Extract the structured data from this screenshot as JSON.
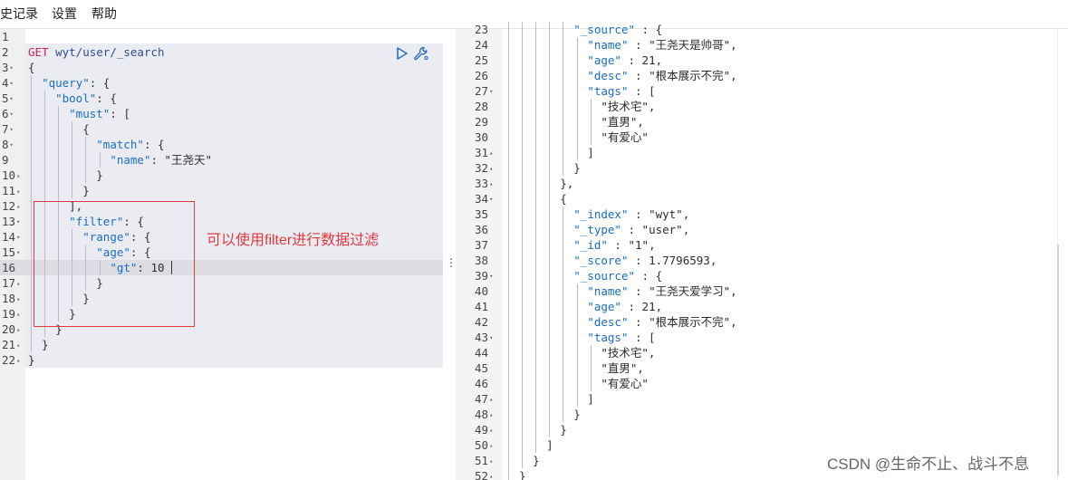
{
  "menu": {
    "items": [
      "史记录",
      "设置",
      "帮助"
    ]
  },
  "request": {
    "method": "GET",
    "url": "wyt/user/_search",
    "lines": [
      "",
      "GET wyt/user/_search",
      "{",
      "  \"query\": {",
      "    \"bool\": {",
      "      \"must\": [",
      "        {",
      "          \"match\": {",
      "            \"name\": \"王尧天\"",
      "          }",
      "        }",
      "      ],",
      "      \"filter\": {",
      "        \"range\": {",
      "          \"age\": {",
      "            \"gt\": 10",
      "          }",
      "        }",
      "      }",
      "    }",
      "  }",
      "}"
    ],
    "gutter": [
      "1",
      "2",
      "3",
      "4",
      "5",
      "6",
      "7",
      "8",
      "9",
      "10",
      "11",
      "12",
      "13",
      "14",
      "15",
      "16",
      "17",
      "18",
      "19",
      "20",
      "21",
      "22"
    ],
    "fold_down": [
      "3",
      "4",
      "5",
      "6",
      "7",
      "8",
      "13",
      "14",
      "15"
    ],
    "fold_up": [
      "10",
      "11",
      "12",
      "17",
      "18",
      "19",
      "20",
      "21",
      "22"
    ]
  },
  "annotation": {
    "text": "可以使用filter进行数据过滤",
    "color": "#e0393e"
  },
  "response": {
    "gutter": [
      "23",
      "24",
      "25",
      "26",
      "27",
      "28",
      "29",
      "30",
      "31",
      "32",
      "33",
      "34",
      "35",
      "36",
      "37",
      "38",
      "39",
      "40",
      "41",
      "42",
      "43",
      "44",
      "45",
      "46",
      "47",
      "48",
      "49",
      "50",
      "51",
      "52"
    ],
    "fold_down": [
      "27",
      "34",
      "39",
      "43"
    ],
    "fold_up": [
      "31",
      "32",
      "33",
      "47",
      "48",
      "49",
      "50",
      "51",
      "52"
    ],
    "lines": [
      "          \"_source\" : {",
      "            \"name\" : \"王尧天是帅哥\",",
      "            \"age\" : 21,",
      "            \"desc\" : \"根本展示不完\",",
      "            \"tags\" : [",
      "              \"技术宅\",",
      "              \"直男\",",
      "              \"有爱心\"",
      "            ]",
      "          }",
      "        },",
      "        {",
      "          \"_index\" : \"wyt\",",
      "          \"_type\" : \"user\",",
      "          \"_id\" : \"1\",",
      "          \"_score\" : 1.7796593,",
      "          \"_source\" : {",
      "            \"name\" : \"王尧天爱学习\",",
      "            \"age\" : 21,",
      "            \"desc\" : \"根本展示不完\",",
      "            \"tags\" : [",
      "              \"技术宅\",",
      "              \"直男\",",
      "              \"有爱心\"",
      "            ]",
      "          }",
      "        }",
      "      ]",
      "    }",
      "  }"
    ]
  },
  "watermark": "CSDN @生命不止、战斗不息",
  "colors": {
    "method": "#c7254e",
    "key": "#1a6dbf",
    "request_bg": "#eaecf2",
    "active_line": "#dcdde3"
  },
  "icons": [
    "play-icon",
    "wrench-icon",
    "splitter-handle-icon"
  ]
}
